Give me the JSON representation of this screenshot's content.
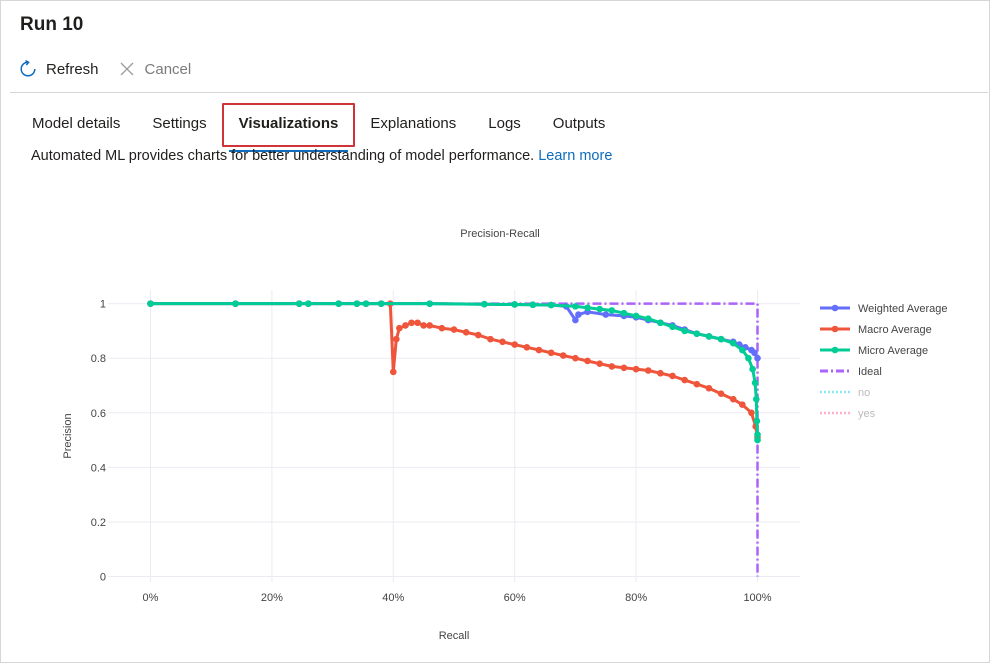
{
  "window": {
    "title": "Run 10"
  },
  "commands": {
    "refresh": "Refresh",
    "cancel": "Cancel"
  },
  "tabs": [
    {
      "label": "Model details"
    },
    {
      "label": "Settings"
    },
    {
      "label": "Visualizations",
      "active": true
    },
    {
      "label": "Explanations"
    },
    {
      "label": "Logs"
    },
    {
      "label": "Outputs"
    }
  ],
  "description": {
    "text": "Automated ML provides charts for better understanding of model performance.",
    "link": "Learn more"
  },
  "colors": {
    "accent": "#0f6cbd",
    "highlight": "#d13438"
  },
  "chart_data": {
    "type": "line",
    "title": "Precision-Recall",
    "xlabel": "Recall",
    "ylabel": "Precision",
    "xlim": [
      -0.07,
      1.07
    ],
    "ylim": [
      -0.02,
      1.05
    ],
    "xticks": [
      0,
      0.2,
      0.4,
      0.6,
      0.8,
      1.0
    ],
    "xtick_labels": [
      "0%",
      "20%",
      "40%",
      "60%",
      "80%",
      "100%"
    ],
    "yticks": [
      0,
      0.2,
      0.4,
      0.6,
      0.8,
      1
    ],
    "ytick_labels": [
      "0",
      "0.2",
      "0.4",
      "0.6",
      "0.8",
      "1"
    ],
    "grid": true,
    "legend_position": "right",
    "series": [
      {
        "name": "Weighted Average",
        "color": "#636efa",
        "style": "line-markers",
        "x": [
          0,
          0.14,
          0.245,
          0.26,
          0.31,
          0.34,
          0.355,
          0.38,
          0.46,
          0.55,
          0.6,
          0.63,
          0.66,
          0.685,
          0.7,
          0.705,
          0.72,
          0.75,
          0.78,
          0.8,
          0.82,
          0.84,
          0.86,
          0.88,
          0.9,
          0.92,
          0.94,
          0.96,
          0.97,
          0.98,
          0.99,
          0.995,
          1.0
        ],
        "y": [
          1,
          1,
          1,
          1,
          1,
          1,
          1,
          1,
          1,
          0.998,
          0.997,
          0.996,
          0.995,
          0.99,
          0.94,
          0.96,
          0.97,
          0.96,
          0.955,
          0.95,
          0.94,
          0.93,
          0.92,
          0.905,
          0.89,
          0.88,
          0.87,
          0.86,
          0.85,
          0.84,
          0.83,
          0.82,
          0.8
        ]
      },
      {
        "name": "Macro Average",
        "color": "#ef553b",
        "style": "line-markers",
        "x": [
          0,
          0.14,
          0.245,
          0.26,
          0.31,
          0.34,
          0.355,
          0.38,
          0.395,
          0.4,
          0.405,
          0.41,
          0.42,
          0.43,
          0.44,
          0.45,
          0.46,
          0.48,
          0.5,
          0.52,
          0.54,
          0.56,
          0.58,
          0.6,
          0.62,
          0.64,
          0.66,
          0.68,
          0.7,
          0.72,
          0.74,
          0.76,
          0.78,
          0.8,
          0.82,
          0.84,
          0.86,
          0.88,
          0.9,
          0.92,
          0.94,
          0.96,
          0.975,
          0.99,
          0.997,
          1.0
        ],
        "y": [
          1,
          1,
          1,
          1,
          1,
          1,
          1,
          1,
          1,
          0.75,
          0.87,
          0.91,
          0.92,
          0.93,
          0.93,
          0.92,
          0.92,
          0.91,
          0.905,
          0.895,
          0.885,
          0.87,
          0.86,
          0.85,
          0.84,
          0.83,
          0.82,
          0.81,
          0.8,
          0.79,
          0.78,
          0.77,
          0.765,
          0.76,
          0.755,
          0.745,
          0.735,
          0.72,
          0.705,
          0.69,
          0.67,
          0.65,
          0.63,
          0.6,
          0.55,
          0.51
        ]
      },
      {
        "name": "Micro Average",
        "color": "#00cc96",
        "style": "line-markers",
        "x": [
          0,
          0.14,
          0.245,
          0.26,
          0.31,
          0.34,
          0.355,
          0.38,
          0.46,
          0.55,
          0.6,
          0.63,
          0.66,
          0.7,
          0.72,
          0.74,
          0.76,
          0.78,
          0.8,
          0.82,
          0.84,
          0.86,
          0.88,
          0.9,
          0.92,
          0.94,
          0.96,
          0.975,
          0.985,
          0.992,
          0.996,
          0.998,
          0.999,
          1.0,
          1.0
        ],
        "y": [
          1,
          1,
          1,
          1,
          1,
          1,
          1,
          1,
          1,
          0.998,
          0.997,
          0.996,
          0.995,
          0.99,
          0.985,
          0.98,
          0.975,
          0.965,
          0.955,
          0.945,
          0.93,
          0.915,
          0.9,
          0.89,
          0.88,
          0.87,
          0.855,
          0.83,
          0.8,
          0.76,
          0.71,
          0.65,
          0.57,
          0.52,
          0.5
        ]
      },
      {
        "name": "Ideal",
        "color": "#ab63fa",
        "style": "dashdot",
        "x": [
          0,
          1,
          1
        ],
        "y": [
          1,
          1,
          0
        ]
      },
      {
        "name": "no",
        "color": "#19d3f3",
        "style": "dotted",
        "muted": true
      },
      {
        "name": "yes",
        "color": "#ff6692",
        "style": "dotted",
        "muted": true
      }
    ]
  }
}
